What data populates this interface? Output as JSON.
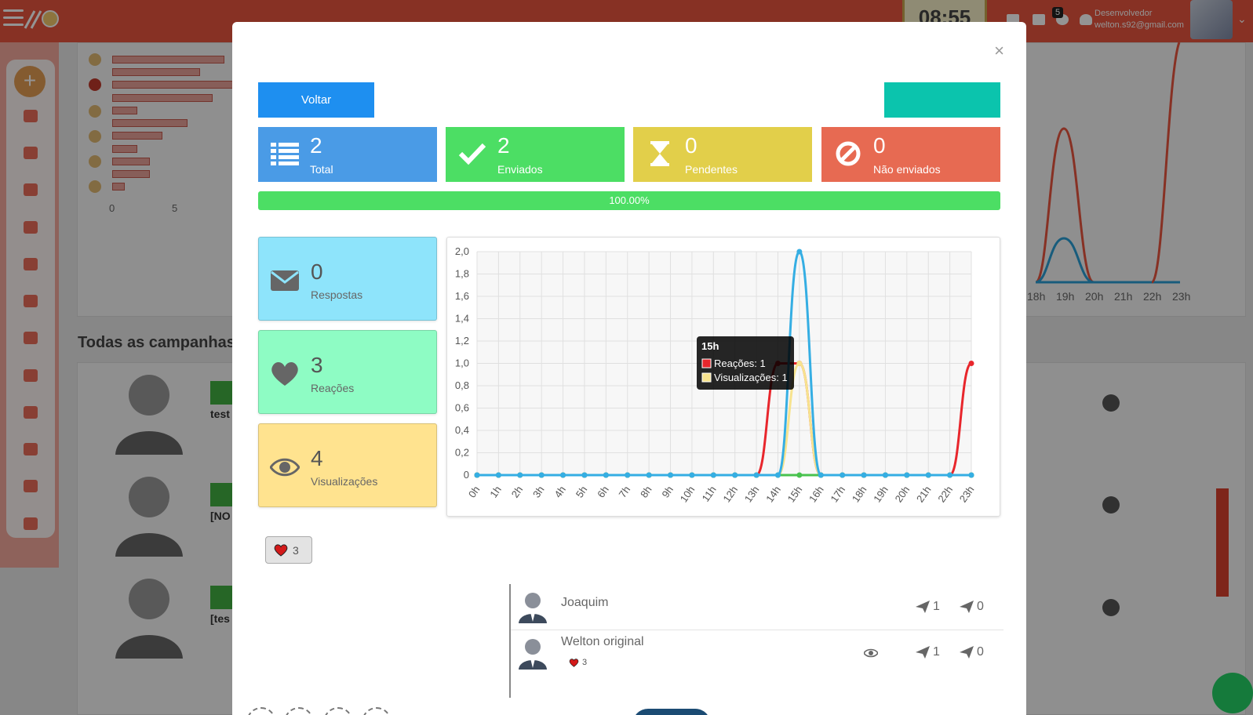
{
  "background": {
    "clock": "08:55",
    "notif_count": "5",
    "user_role": "Desenvolvedor",
    "user_email": "welton.s92@gmail.com",
    "section_title": "Todas as campanhas",
    "axis_left": [
      "0",
      "5"
    ],
    "axis_right": [
      "18h",
      "19h",
      "20h",
      "21h",
      "22h",
      "23h"
    ],
    "row_texts": [
      "test",
      "[NO",
      "[tes"
    ]
  },
  "modal": {
    "close_label": "×",
    "back_label": "Voltar",
    "stats": [
      {
        "value": "2",
        "label": "Total",
        "color": "#4a9be6",
        "icon": "list-icon"
      },
      {
        "value": "2",
        "label": "Enviados",
        "color": "#4cde64",
        "icon": "check-icon"
      },
      {
        "value": "0",
        "label": "Pendentes",
        "color": "#e2cf4a",
        "icon": "hourglass-icon"
      },
      {
        "value": "0",
        "label": "Não enviados",
        "color": "#e76a52",
        "icon": "ban-icon"
      }
    ],
    "progress": {
      "label": "100.00%",
      "percent": 100
    },
    "mini_stats": [
      {
        "value": "0",
        "label": "Respostas",
        "color": "#8ee4fb",
        "icon": "envelope-icon"
      },
      {
        "value": "3",
        "label": "Reações",
        "color": "#8efcc4",
        "icon": "heart-icon"
      },
      {
        "value": "4",
        "label": "Visualizações",
        "color": "#ffe38f",
        "icon": "eye-icon"
      }
    ],
    "reaction_pill": {
      "count": "3"
    },
    "people": [
      {
        "name": "Joaquim",
        "sent_a": "1",
        "sent_b": "0"
      },
      {
        "name": "Welton original",
        "reactions": "3",
        "sent_a": "1",
        "sent_b": "0"
      }
    ]
  },
  "chart_data": {
    "type": "line",
    "categories": [
      "0h",
      "1h",
      "2h",
      "3h",
      "4h",
      "5h",
      "6h",
      "7h",
      "8h",
      "9h",
      "10h",
      "11h",
      "12h",
      "13h",
      "14h",
      "15h",
      "16h",
      "17h",
      "18h",
      "19h",
      "20h",
      "21h",
      "22h",
      "23h"
    ],
    "y_ticks": [
      "0",
      "0,2",
      "0,4",
      "0,6",
      "0,8",
      "1,0",
      "1,2",
      "1,4",
      "1,6",
      "1,8",
      "2,0"
    ],
    "ylim": [
      0,
      2
    ],
    "grid": true,
    "series": [
      {
        "name": "Reações",
        "color": "#e8262c",
        "values": [
          0,
          0,
          0,
          0,
          0,
          0,
          0,
          0,
          0,
          0,
          0,
          0,
          0,
          0,
          1,
          1,
          0,
          0,
          0,
          0,
          0,
          0,
          0,
          1
        ]
      },
      {
        "name": "Visualizações",
        "color": "#f7e38e",
        "values": [
          0,
          0,
          0,
          0,
          0,
          0,
          0,
          0,
          0,
          0,
          0,
          0,
          0,
          0,
          0,
          1,
          0,
          0,
          0,
          0,
          0,
          0,
          0,
          0
        ]
      },
      {
        "color": "#48c24e",
        "values": [
          0,
          0,
          0,
          0,
          0,
          0,
          0,
          0,
          0,
          0,
          0,
          0,
          0,
          0,
          0,
          0,
          0,
          0,
          0,
          0,
          0,
          0,
          0,
          0
        ]
      },
      {
        "color": "#35aee3",
        "values": [
          0,
          0,
          0,
          0,
          0,
          0,
          0,
          0,
          0,
          0,
          0,
          0,
          0,
          0,
          0,
          2,
          0,
          0,
          0,
          0,
          0,
          0,
          0,
          0
        ]
      }
    ],
    "tooltip": {
      "title": "15h",
      "lines": [
        "Reações: 1",
        "Visualizações: 1"
      ]
    }
  }
}
